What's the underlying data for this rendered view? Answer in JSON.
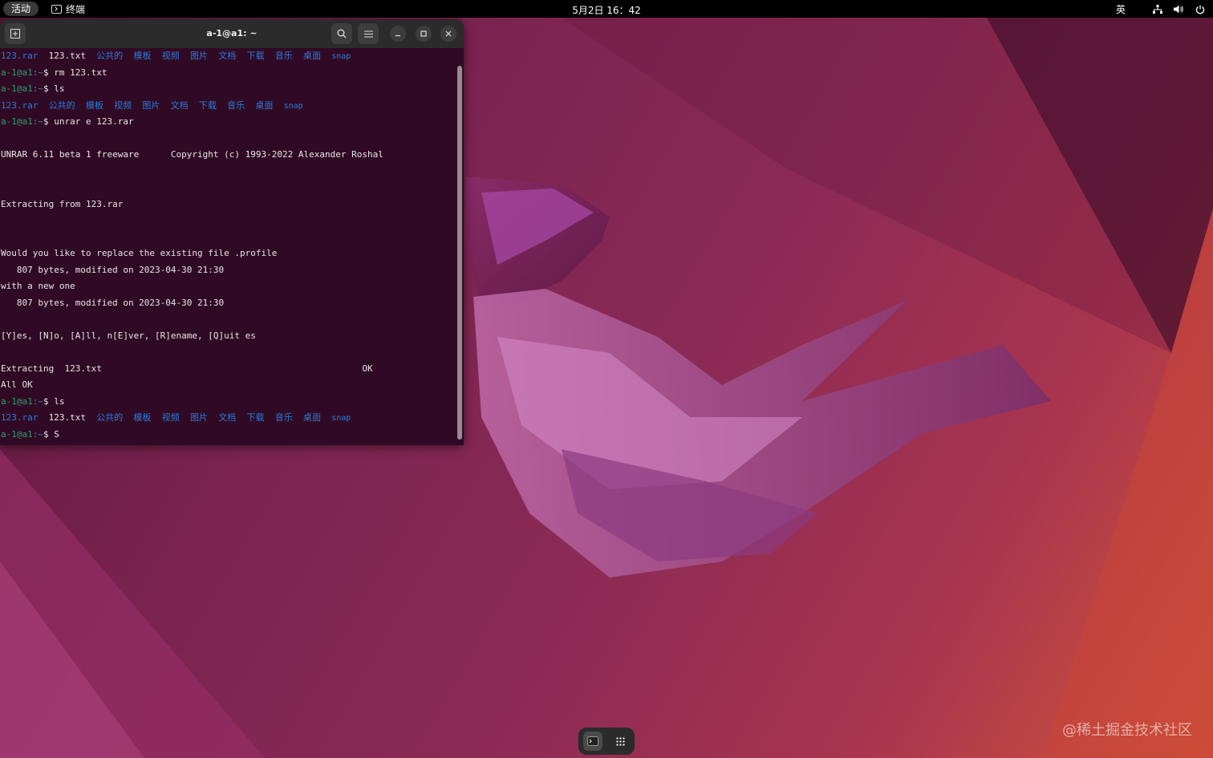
{
  "topbar": {
    "activities": "活动",
    "app_name": "终端",
    "clock": "5月2日  16：42",
    "input_lang": "英"
  },
  "terminal": {
    "title": "a-1@a1: ~",
    "prompt_user": "a-1@a1",
    "prompt_path": ":~",
    "prompt_symbol": "$",
    "lines": [
      {
        "kind": "listing",
        "red": "123.rar",
        "plain": "123.txt",
        "dirs": [
          "公共的",
          "模板",
          "视频",
          "图片",
          "文档",
          "下载",
          "音乐",
          "桌面"
        ],
        "snap": "snap"
      },
      {
        "kind": "prompt",
        "cmd": "rm 123.txt"
      },
      {
        "kind": "prompt",
        "cmd": "ls"
      },
      {
        "kind": "listing",
        "red": "123.rar",
        "plain": "",
        "dirs": [
          "公共的",
          "模板",
          "视频",
          "图片",
          "文档",
          "下载",
          "音乐",
          "桌面"
        ],
        "snap": "snap"
      },
      {
        "kind": "prompt",
        "cmd": "unrar e 123.rar"
      },
      {
        "kind": "text",
        "text": ""
      },
      {
        "kind": "text",
        "text": "UNRAR 6.11 beta 1 freeware      Copyright (c) 1993-2022 Alexander Roshal"
      },
      {
        "kind": "text",
        "text": ""
      },
      {
        "kind": "text",
        "text": ""
      },
      {
        "kind": "text",
        "text": "Extracting from 123.rar"
      },
      {
        "kind": "text",
        "text": ""
      },
      {
        "kind": "text",
        "text": ""
      },
      {
        "kind": "text",
        "text": "Would you like to replace the existing file .profile"
      },
      {
        "kind": "text",
        "text": "   807 bytes, modified on 2023-04-30 21:30"
      },
      {
        "kind": "text",
        "text": "with a new one"
      },
      {
        "kind": "text",
        "text": "   807 bytes, modified on 2023-04-30 21:30"
      },
      {
        "kind": "text",
        "text": ""
      },
      {
        "kind": "text",
        "text": "[Y]es, [N]o, [A]ll, n[E]ver, [R]ename, [Q]uit es"
      },
      {
        "kind": "text",
        "text": ""
      },
      {
        "kind": "text",
        "text": "Extracting  123.txt                                                 OK"
      },
      {
        "kind": "text",
        "text": "All OK"
      },
      {
        "kind": "prompt",
        "cmd": "ls"
      },
      {
        "kind": "listing",
        "red": "123.rar",
        "plain": "123.txt",
        "dirs": [
          "公共的",
          "模板",
          "视频",
          "图片",
          "文档",
          "下载",
          "音乐",
          "桌面"
        ],
        "snap": "snap"
      },
      {
        "kind": "prompt",
        "cmd": "S"
      }
    ]
  },
  "watermark": "@稀土掘金技术社区",
  "icons": {
    "new_tab": "new-tab-icon",
    "search": "search-icon",
    "menu": "hamburger-menu-icon",
    "minimize": "minimize-icon",
    "maximize": "maximize-icon",
    "close": "close-icon",
    "network": "network-icon",
    "volume": "volume-icon",
    "power": "power-icon",
    "terminal": "terminal-icon",
    "apps_grid": "apps-grid-icon"
  },
  "colors": {
    "terminal_bg": "#300a24",
    "prompt_user": "#26a269",
    "prompt_path": "#4c7dd8",
    "archive_file": "#c01c28",
    "directory": "#2a7bde"
  }
}
